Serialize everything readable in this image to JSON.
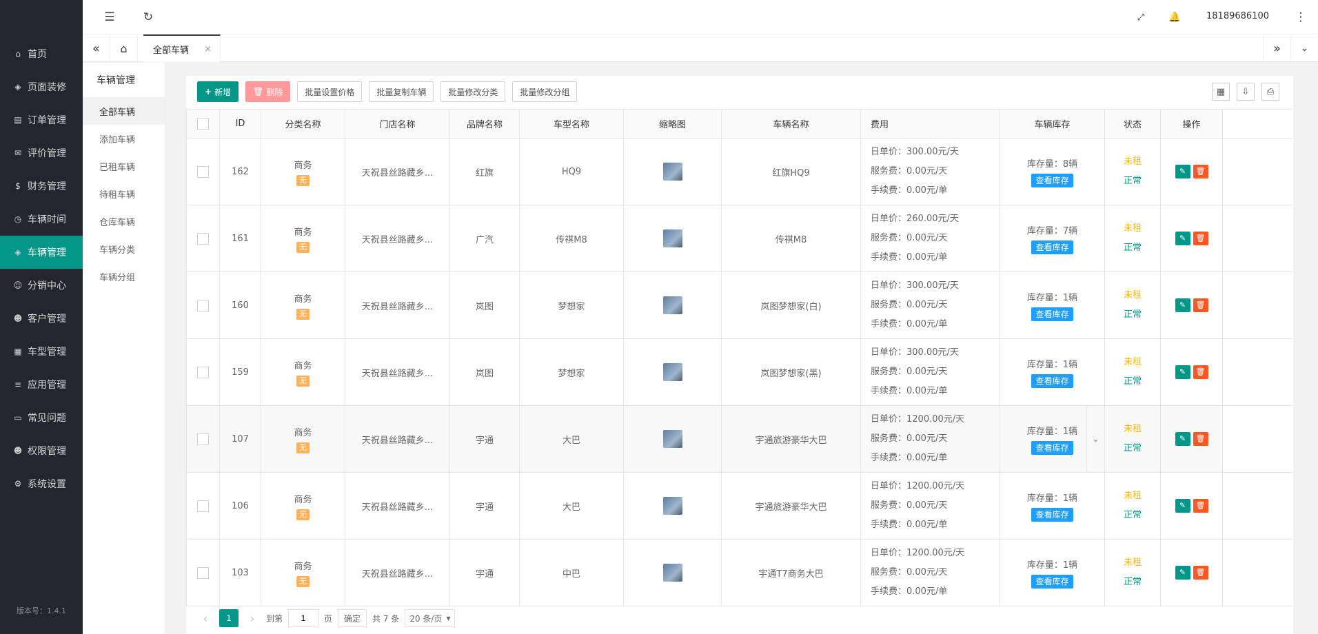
{
  "sidebar": {
    "items": [
      {
        "label": "首页",
        "icon": "home-icon"
      },
      {
        "label": "页面装修",
        "icon": "cube-icon"
      },
      {
        "label": "订单管理",
        "icon": "order-icon"
      },
      {
        "label": "评价管理",
        "icon": "comment-icon"
      },
      {
        "label": "财务管理",
        "icon": "money-bag-icon"
      },
      {
        "label": "车辆时间",
        "icon": "clock-icon"
      },
      {
        "label": "车辆管理",
        "icon": "cube-icon",
        "active": true
      },
      {
        "label": "分销中心",
        "icon": "users-icon"
      },
      {
        "label": "客户管理",
        "icon": "user-icon"
      },
      {
        "label": "车型管理",
        "icon": "grid-icon"
      },
      {
        "label": "应用管理",
        "icon": "database-icon"
      },
      {
        "label": "常见问题",
        "icon": "file-icon"
      },
      {
        "label": "权限管理",
        "icon": "user-icon"
      },
      {
        "label": "系统设置",
        "icon": "gear-icon"
      }
    ],
    "version": "版本号：1.4.1"
  },
  "header": {
    "user": "18189686100"
  },
  "tabs": {
    "active_label": "全部车辆",
    "close": "×"
  },
  "submenu": {
    "title": "车辆管理",
    "items": [
      "全部车辆",
      "添加车辆",
      "已租车辆",
      "待租车辆",
      "仓库车辆",
      "车辆分类",
      "车辆分组"
    ]
  },
  "toolbar": {
    "add": "新增",
    "delete": "删除",
    "batch_price": "批量设置价格",
    "batch_copy": "批量复制车辆",
    "batch_category": "批量修改分类",
    "batch_group": "批量修改分组"
  },
  "table": {
    "headers": [
      "ID",
      "分类名称",
      "门店名称",
      "品牌名称",
      "车型名称",
      "缩略图",
      "车辆名称",
      "费用",
      "车辆库存",
      "状态",
      "操作"
    ],
    "rows": [
      {
        "id": "162",
        "category": "商务",
        "tag": "无",
        "store": "天祝县丝路藏乡...",
        "brand": "红旗",
        "model": "HQ9",
        "name": "红旗HQ9",
        "fee_day": "日单价：300.00元/天",
        "fee_service": "服务费：0.00元/天",
        "fee_handling": "手续费：0.00元/单",
        "stock": "库存量：8辆",
        "stock_btn": "查看库存",
        "status1": "未租",
        "status2": "正常"
      },
      {
        "id": "161",
        "category": "商务",
        "tag": "无",
        "store": "天祝县丝路藏乡...",
        "brand": "广汽",
        "model": "传祺M8",
        "name": "传祺M8",
        "fee_day": "日单价：260.00元/天",
        "fee_service": "服务费：0.00元/天",
        "fee_handling": "手续费：0.00元/单",
        "stock": "库存量：7辆",
        "stock_btn": "查看库存",
        "status1": "未租",
        "status2": "正常"
      },
      {
        "id": "160",
        "category": "商务",
        "tag": "无",
        "store": "天祝县丝路藏乡...",
        "brand": "岚图",
        "model": "梦想家",
        "name": "岚图梦想家(白)",
        "fee_day": "日单价：300.00元/天",
        "fee_service": "服务费：0.00元/天",
        "fee_handling": "手续费：0.00元/单",
        "stock": "库存量：1辆",
        "stock_btn": "查看库存",
        "status1": "未租",
        "status2": "正常"
      },
      {
        "id": "159",
        "category": "商务",
        "tag": "无",
        "store": "天祝县丝路藏乡...",
        "brand": "岚图",
        "model": "梦想家",
        "name": "岚图梦想家(黑)",
        "fee_day": "日单价：300.00元/天",
        "fee_service": "服务费：0.00元/天",
        "fee_handling": "手续费：0.00元/单",
        "stock": "库存量：1辆",
        "stock_btn": "查看库存",
        "status1": "未租",
        "status2": "正常"
      },
      {
        "id": "107",
        "category": "商务",
        "tag": "无",
        "store": "天祝县丝路藏乡...",
        "brand": "宇通",
        "model": "大巴",
        "name": "宇通旅游豪华大巴",
        "fee_day": "日单价：1200.00元/天",
        "fee_service": "服务费：0.00元/天",
        "fee_handling": "手续费：0.00元/单",
        "stock": "库存量：1辆",
        "stock_btn": "查看库存",
        "status1": "未租",
        "status2": "正常"
      },
      {
        "id": "106",
        "category": "商务",
        "tag": "无",
        "store": "天祝县丝路藏乡...",
        "brand": "宇通",
        "model": "大巴",
        "name": "宇通旅游豪华大巴",
        "fee_day": "日单价：1200.00元/天",
        "fee_service": "服务费：0.00元/天",
        "fee_handling": "手续费：0.00元/单",
        "stock": "库存量：1辆",
        "stock_btn": "查看库存",
        "status1": "未租",
        "status2": "正常"
      },
      {
        "id": "103",
        "category": "商务",
        "tag": "无",
        "store": "天祝县丝路藏乡...",
        "brand": "宇通",
        "model": "中巴",
        "name": "宇通T7商务大巴",
        "fee_day": "日单价：1200.00元/天",
        "fee_service": "服务费：0.00元/天",
        "fee_handling": "手续费：0.00元/单",
        "stock": "库存量：1辆",
        "stock_btn": "查看库存",
        "status1": "未租",
        "status2": "正常"
      }
    ]
  },
  "pager": {
    "current": "1",
    "goto": "到第",
    "page_input": "1",
    "page_unit": "页",
    "confirm": "确定",
    "total": "共 7 条",
    "per_page": "20 条/页"
  }
}
